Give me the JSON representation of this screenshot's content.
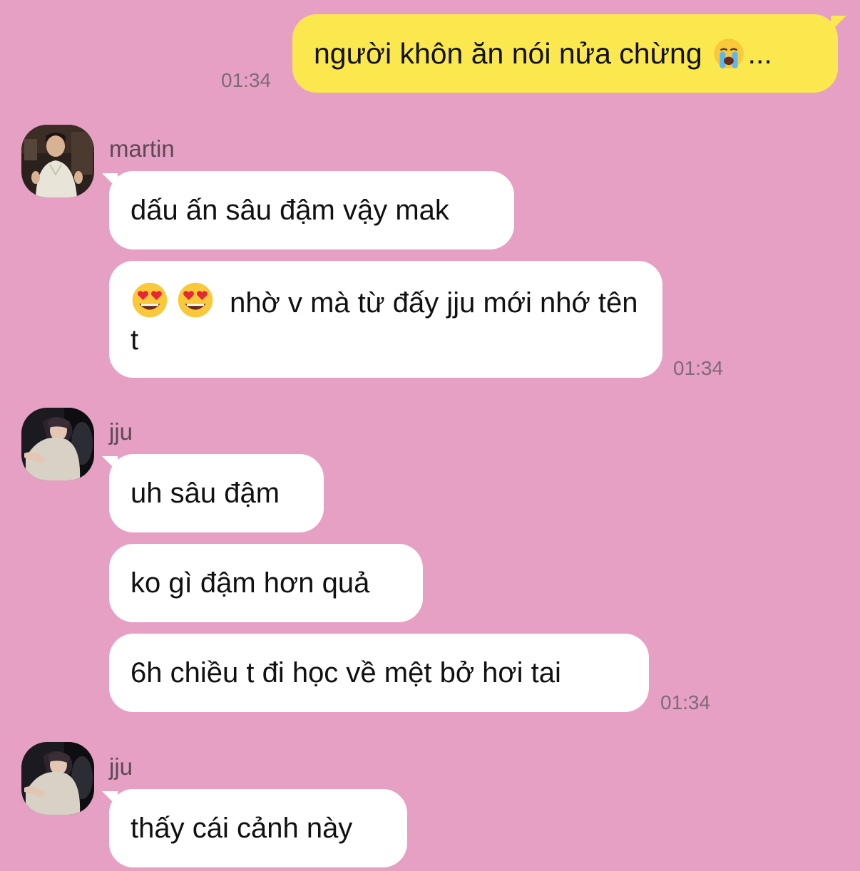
{
  "colors": {
    "background": "#e6a0c3",
    "outgoing_bubble": "#fbe74e",
    "incoming_bubble": "#ffffff",
    "timestamp": "#7d6a74"
  },
  "messages": {
    "outgoing": {
      "text": "người khôn ăn nói nửa chừng",
      "emoji": "loudly-crying-face-icon",
      "suffix": "...",
      "time": "01:34"
    },
    "group_martin": {
      "sender": "martin",
      "avatar": "martin-avatar",
      "msg1": "dấu ấn sâu đậm vậy mak",
      "msg2_emoji": "heart-eyes-face-icon",
      "msg2_text": "nhờ v mà từ đấy jju mới nhớ tên t",
      "time": "01:34"
    },
    "group_jju_1": {
      "sender": "jju",
      "avatar": "jju-avatar",
      "msg1": "uh sâu đậm",
      "msg2": "ko gì đậm hơn quả",
      "msg3": "6h chiều t đi học về mệt bở hơi tai",
      "time": "01:34"
    },
    "group_jju_2": {
      "sender": "jju",
      "avatar": "jju-avatar",
      "msg1": "thấy cái cảnh này"
    }
  }
}
